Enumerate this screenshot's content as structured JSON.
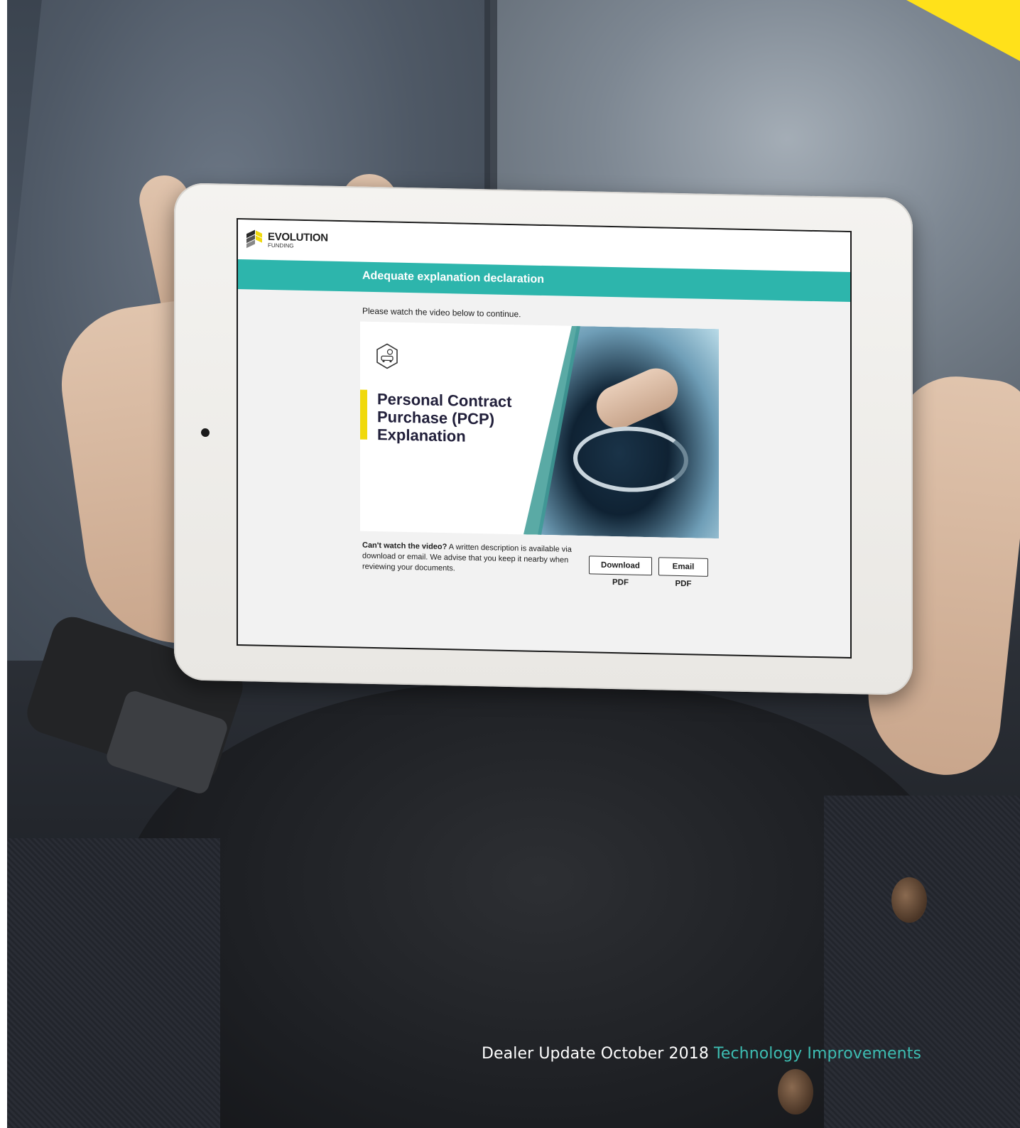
{
  "app": {
    "logo_name": "EVOLUTION",
    "logo_sub": "FUNDING",
    "page_title": "Adequate explanation declaration",
    "instruction": "Please watch the video below to continue."
  },
  "video": {
    "title_line1": "Personal Contract",
    "title_line2": "Purchase (PCP)",
    "title_line3": "Explanation",
    "icon": "car-finance-hexagon-icon"
  },
  "fallback": {
    "lead": "Can't watch the video?",
    "text": " A written description is available via download or email. We advise that you keep it nearby when reviewing your documents.",
    "download_label": "Download PDF",
    "email_label": "Email PDF"
  },
  "caption": {
    "main": "Dealer Update October 2018 ",
    "accent": "Technology Improvements"
  },
  "colors": {
    "teal": "#2db5ac",
    "yellow": "#f0d90c",
    "navy": "#211f3a",
    "caption_accent": "#3dbdb2"
  }
}
